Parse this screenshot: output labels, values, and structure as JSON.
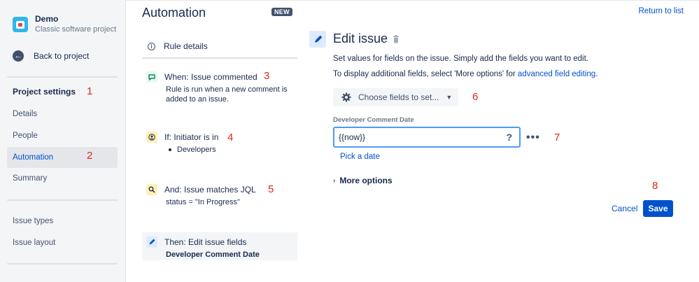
{
  "project": {
    "name": "Demo",
    "subtitle": "Classic software project"
  },
  "sidebar": {
    "back_label": "Back to project",
    "section_title": "Project settings",
    "items": [
      {
        "label": "Details"
      },
      {
        "label": "People"
      },
      {
        "label": "Automation",
        "active": true
      },
      {
        "label": "Summary"
      },
      {
        "label": "Issue types"
      },
      {
        "label": "Issue layout"
      }
    ]
  },
  "header": {
    "title": "Automation",
    "badge": "NEW",
    "return_link": "Return to list"
  },
  "rule": {
    "details_label": "Rule details",
    "steps": [
      {
        "title": "When: Issue commented",
        "body": "Rule is run when a new comment is added to an issue.",
        "icon": "comment-icon",
        "color": "#e3fcef"
      },
      {
        "title": "If: Initiator is in",
        "body": "Developers",
        "icon": "user-icon",
        "color": "#fff0b3"
      },
      {
        "title": "And: Issue matches JQL",
        "body": "status = \"In Progress\"",
        "icon": "search-icon",
        "color": "#fff0b3"
      },
      {
        "title": "Then: Edit issue fields",
        "body": "Developer Comment Date",
        "icon": "pencil-icon",
        "color": "#deebff"
      }
    ]
  },
  "editor": {
    "title": "Edit issue",
    "description": "Set values for fields on the issue. Simply add the fields you want to edit.",
    "additional_prefix": "To display additional fields, select 'More options' for ",
    "additional_link": "advanced field editing",
    "additional_suffix": ".",
    "choose_fields_label": "Choose fields to set...",
    "field_label": "Developer Comment Date",
    "field_value": "{{now}}",
    "field_help": "?",
    "field_more": "•••",
    "pick_date": "Pick a date",
    "more_options": "More options",
    "cancel": "Cancel",
    "save": "Save"
  },
  "annotations": [
    "1",
    "2",
    "3",
    "4",
    "5",
    "6",
    "7",
    "8"
  ],
  "colors": {
    "accent": "#0052cc",
    "annotation": "#e0261b",
    "focus": "#4c9aff"
  }
}
